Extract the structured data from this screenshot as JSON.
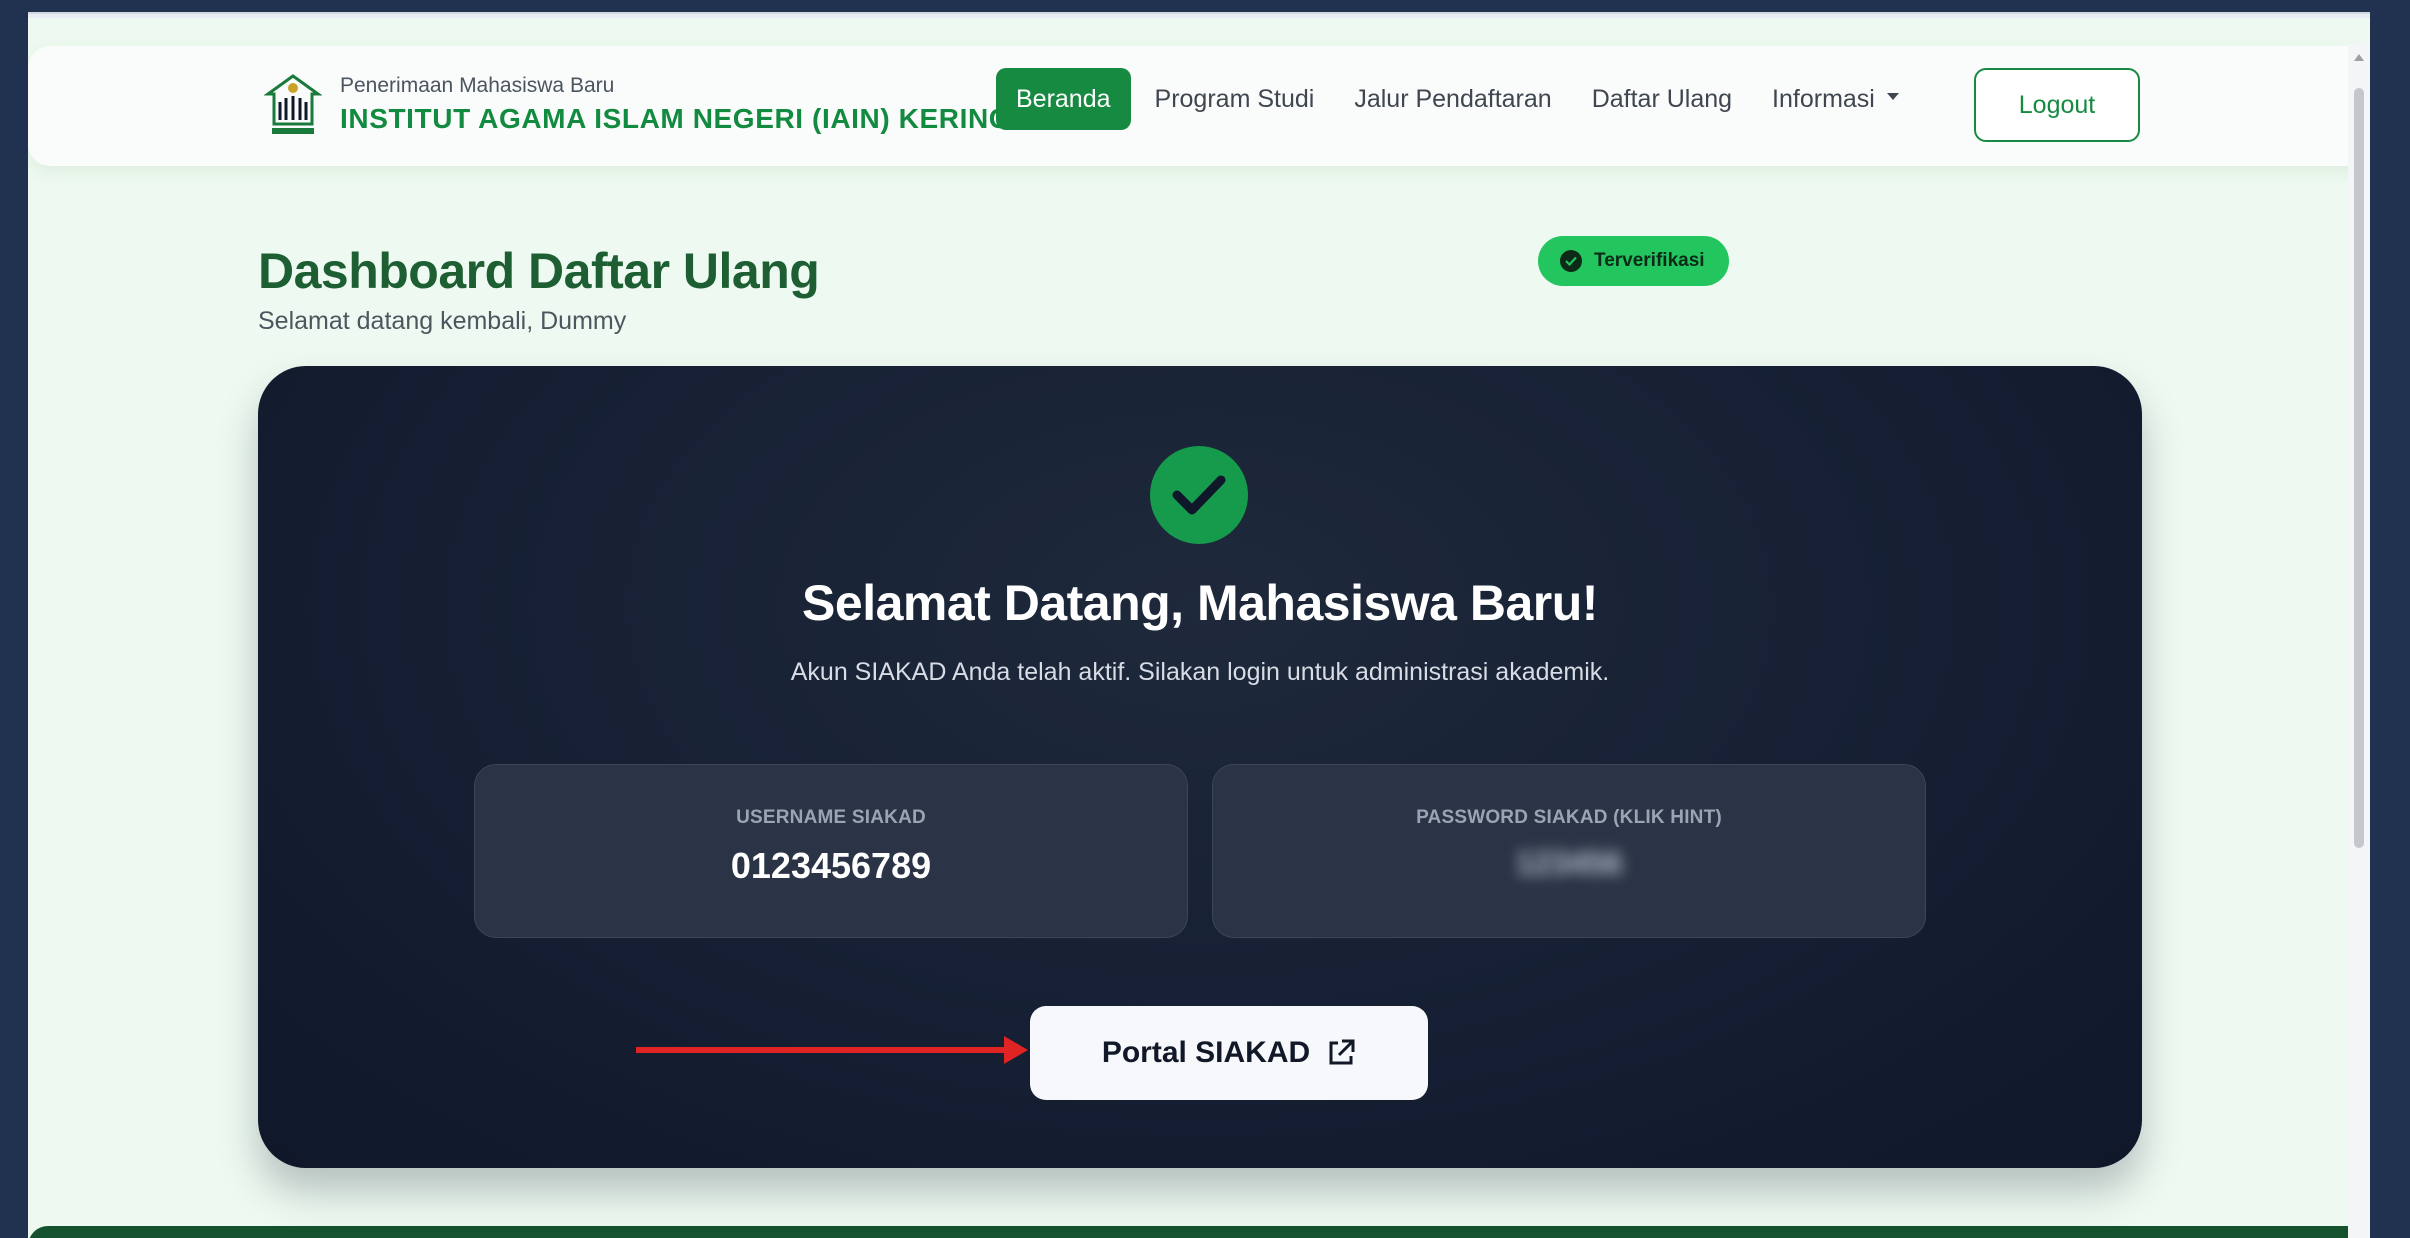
{
  "navbar": {
    "brand_subtitle": "Penerimaan Mahasiswa Baru",
    "brand_title": "INSTITUT AGAMA ISLAM NEGERI (IAIN) KERINCI",
    "links": [
      {
        "label": "Beranda",
        "active": true
      },
      {
        "label": "Program Studi",
        "active": false
      },
      {
        "label": "Jalur Pendaftaran",
        "active": false
      },
      {
        "label": "Daftar Ulang",
        "active": false
      },
      {
        "label": "Informasi",
        "active": false,
        "dropdown": true
      }
    ],
    "logout_label": "Logout"
  },
  "header": {
    "title": "Dashboard Daftar Ulang",
    "subtitle": "Selamat datang kembali, Dummy",
    "badge": "Terverifikasi"
  },
  "card": {
    "title": "Selamat Datang, Mahasiswa Baru!",
    "description": "Akun SIAKAD Anda telah aktif. Silakan login untuk administrasi akademik.",
    "username_label": "USERNAME SIAKAD",
    "username_value": "0123456789",
    "password_label": "PASSWORD SIAKAD (KLIK HINT)",
    "password_value": "123456",
    "portal_button": "Portal SIAKAD"
  },
  "colors": {
    "brand_green": "#168a41",
    "page_bg": "#eefaf1",
    "card_dark": "#0f172a",
    "badge_green": "#22c55e",
    "annotation_arrow": "#e02424"
  },
  "icons": [
    "mosque-logo-icon",
    "check-circle-icon",
    "external-link-icon",
    "chevron-down-icon"
  ]
}
